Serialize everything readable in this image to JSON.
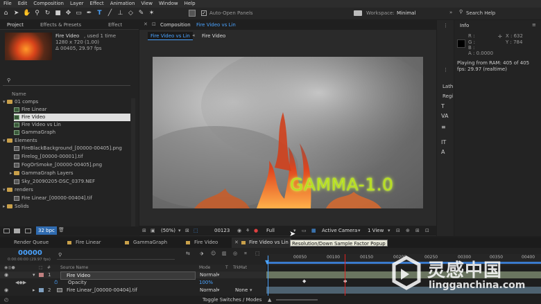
{
  "menu": [
    "File",
    "Edit",
    "Composition",
    "Layer",
    "Effect",
    "Animation",
    "View",
    "Window",
    "Help"
  ],
  "toolbar": {
    "auto_open": "Auto-Open Panels",
    "workspace_label": "Workspace:",
    "workspace_value": "Minimal",
    "search_help": "Search Help"
  },
  "project": {
    "tab": "Project",
    "tab2": "Effects & Presets",
    "tab3": "Effect",
    "comp_name": "Fire Video",
    "comp_used": ", used 1 time",
    "comp_size": "1280 x 720 (1.00)",
    "comp_dur": "Δ 00405, 29.97 fps",
    "col_name": "Name",
    "bpc": "32 bpc",
    "items": [
      "01 comps",
      "Fire Linear",
      "Fire Video",
      "Fire Video vs Lin",
      "GammaGraph",
      "Elements",
      "FireBlackBackground_[00000-00405].png",
      "Firelog_[00000-00001].tif",
      "FogOrSmoke_[00000-00405].png",
      "GammaGraph Layers",
      "Sky_20090205-DSC_0379.NEF",
      "renders",
      "Fire Linear_[00000-00404].tif",
      "Solids"
    ]
  },
  "viewer": {
    "tab_prefix": "Composition",
    "tab_name": "Fire Video vs Lin",
    "sub1": "Fire Video vs Lin",
    "sub2": "Fire Video",
    "overlay_text": "GAMMA-1.0",
    "zoom": "(50%)",
    "frame": "00123",
    "resolution": "Full",
    "camera": "Active Camera",
    "views": "1 View"
  },
  "info": {
    "tab": "Info",
    "r": "R :",
    "g": "G :",
    "b": "B :",
    "a": "A : 0.0000",
    "x": "X : 632",
    "y": "Y : 784",
    "ram": "Playing from RAM: 405 of 405",
    "fps": "fps: 29.97 (realtime)"
  },
  "side": {
    "l1": "Lath",
    "l2": "Regi"
  },
  "timeline": {
    "tabs": [
      "Render Queue",
      "Fire Linear",
      "GammaGraph",
      "Fire Video",
      "Fire Video vs Lin"
    ],
    "tooltip": "Resolution/Down Sample Factor Popup",
    "timecode": "00000",
    "tc_sub": "0:00:00:00 (29.97 fps)",
    "col_source": "Source Name",
    "col_mode": "Mode",
    "col_t": "T",
    "col_trkmat": "TrkMat",
    "layer1_num": "1",
    "layer1": "Fire Video",
    "layer1_mode": "Normal",
    "prop": "Opacity",
    "prop_val": "100%",
    "layer2_num": "2",
    "layer2": "Fire Linear_[00000-00404].tif",
    "layer2_mode": "Normal",
    "layer2_trk": "None",
    "toggle": "Toggle Switches / Modes",
    "ruler": [
      "00050",
      "00100",
      "00150",
      "00200",
      "00250",
      "00300",
      "00350",
      "00400"
    ]
  },
  "watermark": {
    "cn": "灵感中国",
    "en": "lingganchina.com"
  },
  "colors": {
    "accent": "#4aa3ff",
    "playhead": "#e02020",
    "workarea": "#3a7acc"
  }
}
